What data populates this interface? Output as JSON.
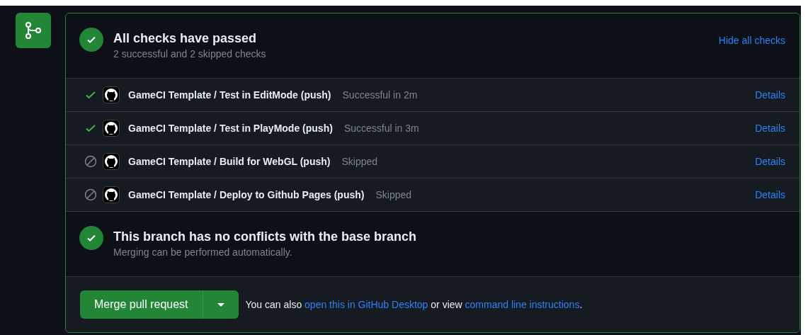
{
  "summary": {
    "title": "All checks have passed",
    "subtitle": "2 successful and 2 skipped checks",
    "toggle": "Hide all checks",
    "kind": "success"
  },
  "checks": [
    {
      "name": "GameCI Template / Test in EditMode (push)",
      "status": "Successful in 2m",
      "kind": "success",
      "details": "Details"
    },
    {
      "name": "GameCI Template / Test in PlayMode (push)",
      "status": "Successful in 3m",
      "kind": "success",
      "details": "Details"
    },
    {
      "name": "GameCI Template / Build for WebGL (push)",
      "status": "Skipped",
      "kind": "skipped",
      "details": "Details"
    },
    {
      "name": "GameCI Template / Deploy to Github Pages (push)",
      "status": "Skipped",
      "kind": "skipped",
      "details": "Details"
    }
  ],
  "conflicts": {
    "title": "This branch has no conflicts with the base branch",
    "subtitle": "Merging can be performed automatically.",
    "kind": "success"
  },
  "merge": {
    "button": "Merge pull request",
    "note": {
      "prefix": "You can also",
      "link_1": "open this in GitHub Desktop",
      "middle": "or view",
      "link_2": "command line instructions",
      "suffix": "."
    }
  }
}
